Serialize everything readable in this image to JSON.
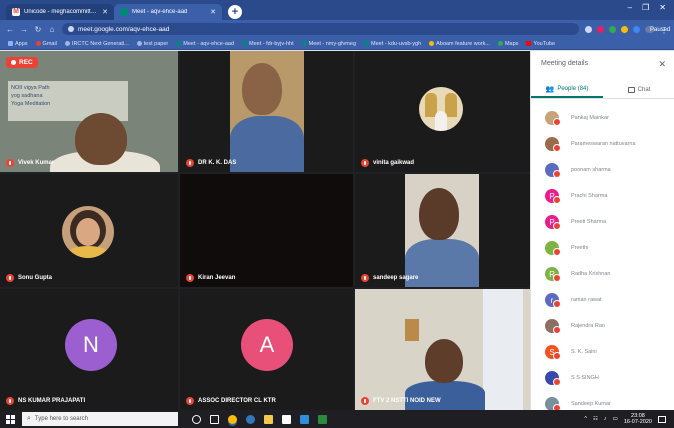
{
  "browser": {
    "tabs": [
      {
        "title": "Unicode - meghacommittee@gy",
        "favicon_color": "#ea4335",
        "active": false
      },
      {
        "title": "Meet - aqv-ehce-aad",
        "favicon_color": "#00897b",
        "active": true
      }
    ],
    "new_tab_symbol": "+",
    "window_controls": [
      "–",
      "❐",
      "✕"
    ],
    "url": "meet.google.com/aqv-ehce-aad",
    "profile_label": "Paused",
    "bookmarks": [
      "Apps",
      "Gmail",
      "IRCTC Next Generati...",
      "test paper",
      "Meet - aqv-ehce-aad",
      "Meet - fdr-byjv-hht",
      "Meet - nmy-gfvmeg",
      "Meet - kdu-uvsb-ygh",
      "Aboam feature work...",
      "Maps",
      "YouTube"
    ]
  },
  "meet": {
    "rec_label": "REC",
    "tiles": [
      {
        "name": "Vivek Kumar"
      },
      {
        "name": "DR K. K. DAS"
      },
      {
        "name": "vinita gaikwad"
      },
      {
        "name": "Sonu Gupta"
      },
      {
        "name": "Kiran Jeevan"
      },
      {
        "name": "sandeep sagare"
      },
      {
        "name": "NS KUMAR PRAJAPATI",
        "initial": "N",
        "color": "#9c5fcf"
      },
      {
        "name": "ASSOC DIRECTOR CL KTR",
        "initial": "A",
        "color": "#e8507a"
      },
      {
        "name": "FTV 2 NSTTI NOID NEW"
      }
    ],
    "whiteboard_lines": [
      "NOII vigya Path",
      "yog sadhana",
      "Yoga Meditation"
    ]
  },
  "panel": {
    "title": "Meeting details",
    "close_symbol": "✕",
    "tabs": [
      {
        "label": "People (84)",
        "icon": "people-icon"
      },
      {
        "label": "Chat",
        "icon": "chat-icon"
      }
    ],
    "people": [
      {
        "name": "Pankaj Mainkar",
        "initial": "",
        "color": "#c8a27a"
      },
      {
        "name": "Parameswaran nattuvarna",
        "initial": "",
        "color": "#9c6b4a"
      },
      {
        "name": "poonam sharma",
        "initial": "",
        "color": "#5c6bc0"
      },
      {
        "name": "Prachi Sharma",
        "initial": "P",
        "color": "#e91e8c"
      },
      {
        "name": "Preeti Sharma",
        "initial": "P",
        "color": "#e91e8c"
      },
      {
        "name": "Preethi",
        "initial": "",
        "color": "#7cb342"
      },
      {
        "name": "Radha Krishnan",
        "initial": "R",
        "color": "#7cb342"
      },
      {
        "name": "raman rawat",
        "initial": "r",
        "color": "#5c6bc0"
      },
      {
        "name": "Rajendra Rao",
        "initial": "",
        "color": "#8d6e63"
      },
      {
        "name": "S. K. Saini",
        "initial": "S",
        "color": "#f4511e"
      },
      {
        "name": "S S SINGH",
        "initial": "",
        "color": "#3949ab"
      },
      {
        "name": "Sandeep Kumar",
        "initial": "",
        "color": "#78909c"
      }
    ]
  },
  "taskbar": {
    "search_placeholder": "Type here to search",
    "time": "23:08",
    "date": "16-07-2020"
  }
}
